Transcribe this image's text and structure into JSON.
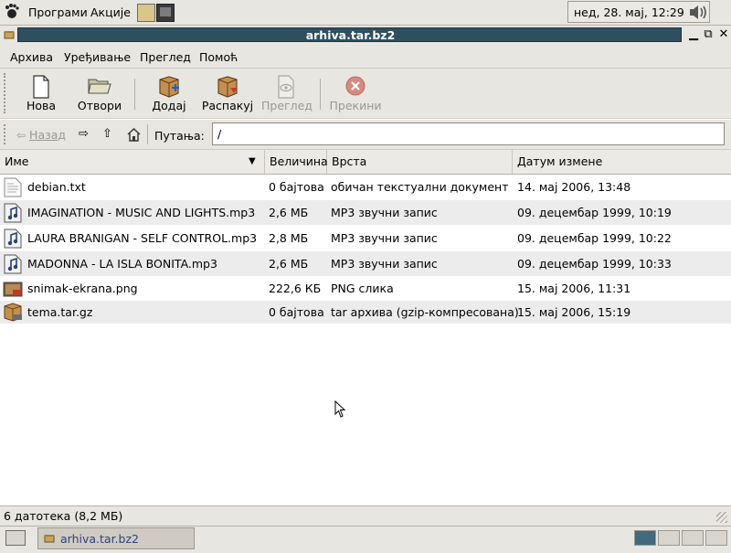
{
  "top_panel": {
    "applications_label": "Програми",
    "actions_label": "Акције",
    "clock": "нед, 28. мај, 12:29"
  },
  "window": {
    "title": "arhiva.tar.bz2"
  },
  "menubar": {
    "items": [
      "Архива",
      "Уређивање",
      "Преглед",
      "Помоћ"
    ]
  },
  "toolbar": {
    "new_label": "Нова",
    "open_label": "Отвори",
    "add_label": "Додај",
    "extract_label": "Распакуј",
    "view_label": "Преглед",
    "stop_label": "Прекини"
  },
  "location": {
    "back_label": "Назад",
    "path_label": "Путања:",
    "path_value": "/"
  },
  "columns": {
    "name": "Име",
    "size": "Величина",
    "type": "Врста",
    "date": "Датум измене"
  },
  "files": [
    {
      "name": "debian.txt",
      "size": "0 бајтова",
      "type": "обичан текстуални документ",
      "date": "14. мај 2006, 13:48",
      "icon": "text-file-icon"
    },
    {
      "name": "IMAGINATION - MUSIC AND LIGHTS.mp3",
      "size": "2,6 МБ",
      "type": "MP3 звучни запис",
      "date": "09. децембар 1999, 10:19",
      "icon": "audio-file-icon"
    },
    {
      "name": "LAURA BRANIGAN - SELF CONTROL.mp3",
      "size": "2,8 МБ",
      "type": "MP3 звучни запис",
      "date": "09. децембар 1999, 10:22",
      "icon": "audio-file-icon"
    },
    {
      "name": "MADONNA - LA ISLA BONITA.mp3",
      "size": "2,6 МБ",
      "type": "MP3 звучни запис",
      "date": "09. децембар 1999, 10:33",
      "icon": "audio-file-icon"
    },
    {
      "name": "snimak-ekrana.png",
      "size": "222,6 КБ",
      "type": "PNG слика",
      "date": "15. мај 2006, 11:31",
      "icon": "image-file-icon"
    },
    {
      "name": "tema.tar.gz",
      "size": "0 бајтова",
      "type": "tar архива (gzip-компресована)",
      "date": "15. мај 2006, 15:19",
      "icon": "archive-file-icon"
    }
  ],
  "status": {
    "text": "6 датотека (8,2 МБ)"
  },
  "taskbar": {
    "task_label": "arhiva.tar.bz2"
  },
  "colors": {
    "title_bar": "#2f4f5f",
    "panel": "#e8e6e1",
    "alt_row": "#ececec"
  }
}
